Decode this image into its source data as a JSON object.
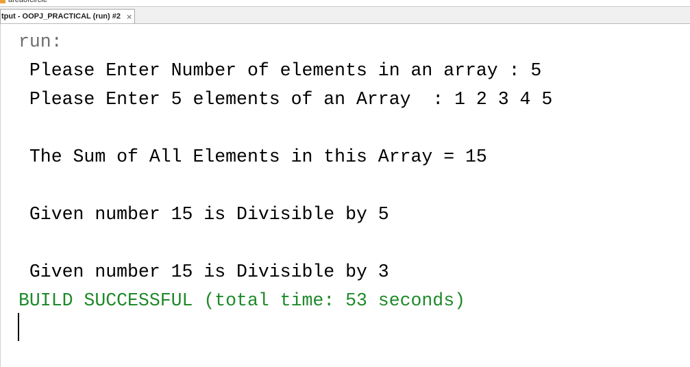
{
  "window": {
    "top_strip_text": "areaofcircle",
    "tab_label": "tput - OOPJ_PRACTICAL (run) #2",
    "tab_close": "×"
  },
  "console": {
    "run_label": "run:",
    "lines": [
      " Please Enter Number of elements in an array : 5",
      " Please Enter 5 elements of an Array  : 1 2 3 4 5",
      "",
      " The Sum of All Elements in this Array = 15",
      "",
      " Given number 15 is Divisible by 5",
      "",
      " Given number 15 is Divisible by 3"
    ],
    "build_status": "BUILD SUCCESSFUL (total time: 53 seconds)"
  },
  "colors": {
    "run_label": "#6f6f6f",
    "output_text": "#000000",
    "build_success": "#1e8a2a"
  }
}
